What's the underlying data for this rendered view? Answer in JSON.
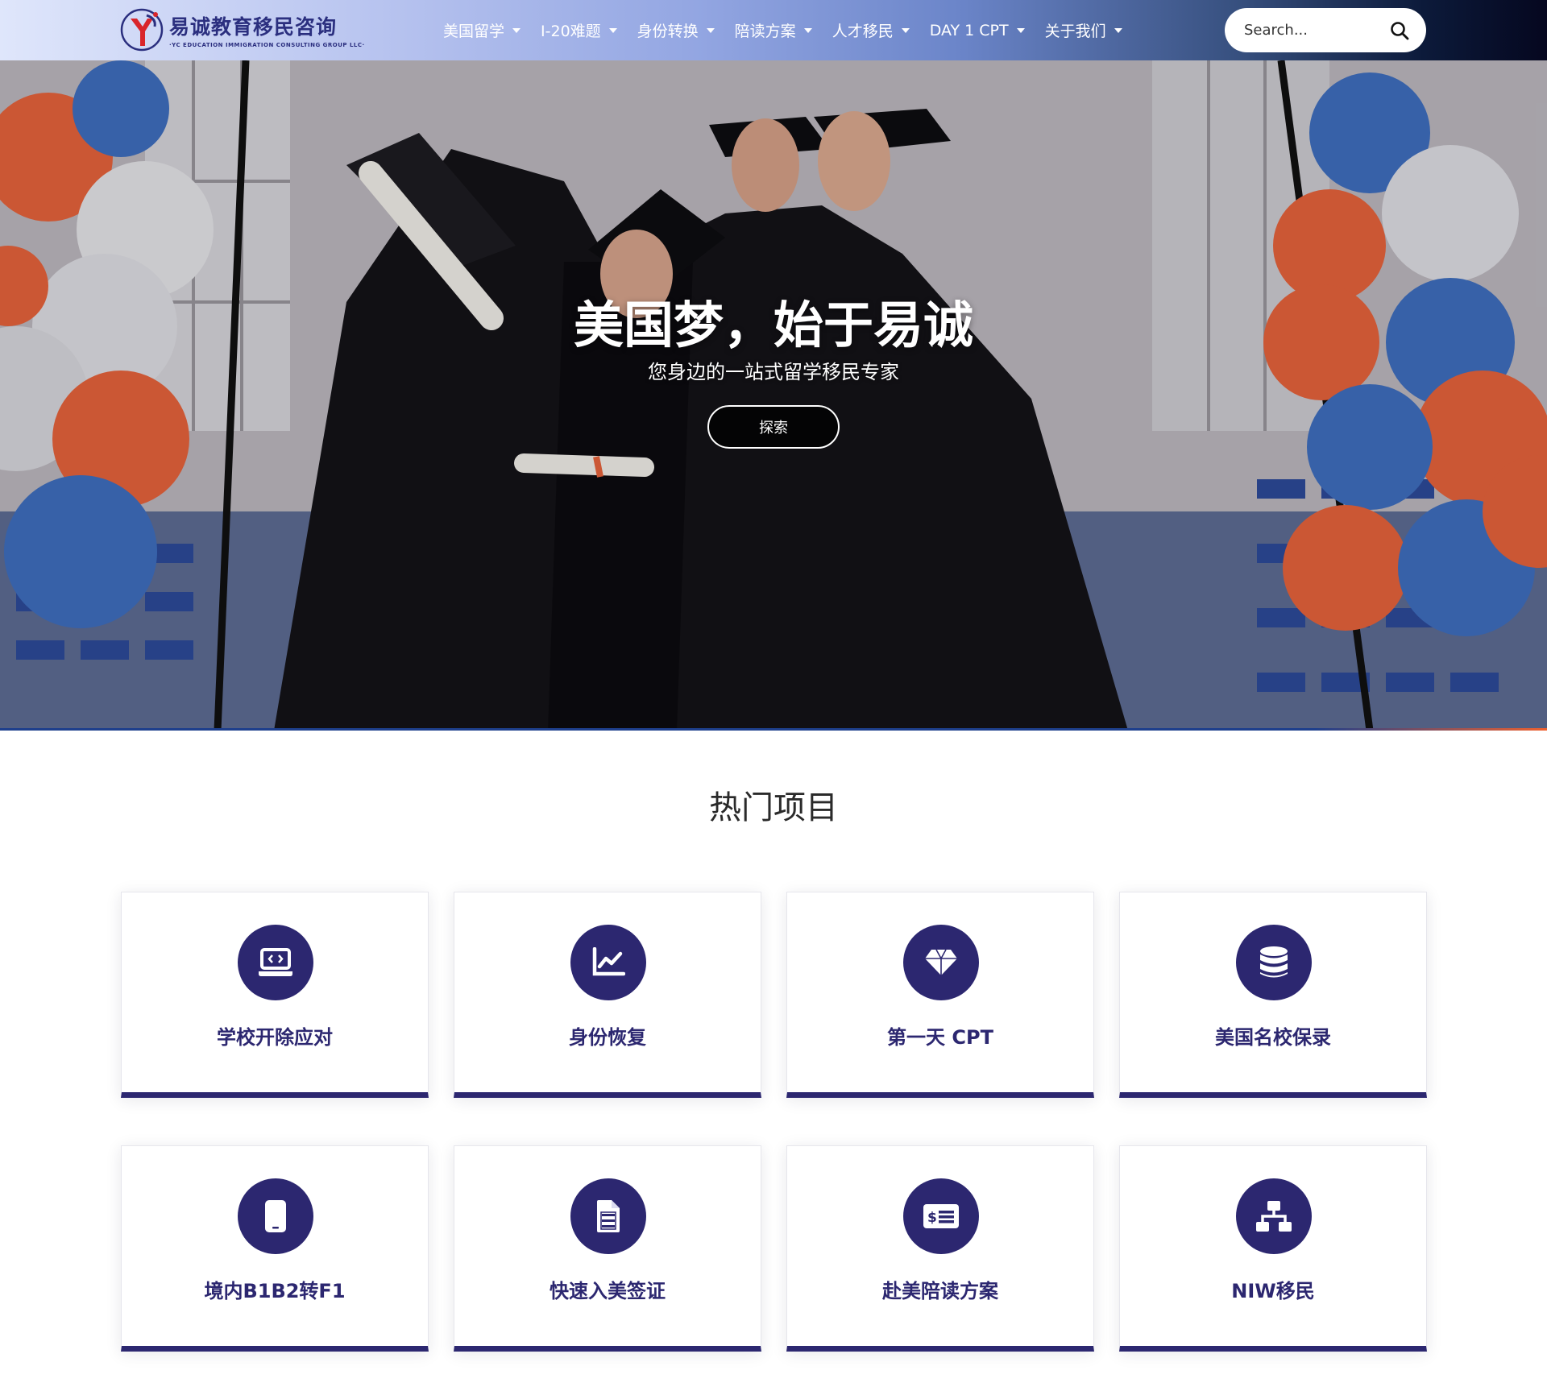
{
  "header": {
    "logo_name": "易诚教育移民咨询",
    "logo_sub": "·YC EDUCATION IMMIGRATION CONSULTING GROUP LLC·",
    "nav": [
      {
        "label": "美国留学"
      },
      {
        "label": "I-20难题"
      },
      {
        "label": "身份转换"
      },
      {
        "label": "陪读方案"
      },
      {
        "label": "人才移民"
      },
      {
        "label": "DAY 1 CPT"
      },
      {
        "label": "关于我们"
      }
    ],
    "search_placeholder": "Search..."
  },
  "hero": {
    "title": "美国梦，始于易诚",
    "subtitle": "您身边的一站式留学移民专家",
    "button": "探索"
  },
  "section": {
    "title": "热门项目",
    "cards": [
      {
        "label": "学校开除应对",
        "icon": "laptop-code-icon"
      },
      {
        "label": "身份恢复",
        "icon": "chart-line-icon"
      },
      {
        "label": "第一天 CPT",
        "icon": "gem-icon"
      },
      {
        "label": "美国名校保录",
        "icon": "database-icon"
      },
      {
        "label": "境内B1B2转F1",
        "icon": "mobile-icon"
      },
      {
        "label": "快速入美签证",
        "icon": "file-alt-icon"
      },
      {
        "label": "赴美陪读方案",
        "icon": "money-check-icon"
      },
      {
        "label": "NIW移民",
        "icon": "sitemap-icon"
      }
    ]
  },
  "colors": {
    "primary": "#2c2770",
    "balloon_orange": "#e8633c",
    "balloon_blue": "#3f6fc0"
  }
}
